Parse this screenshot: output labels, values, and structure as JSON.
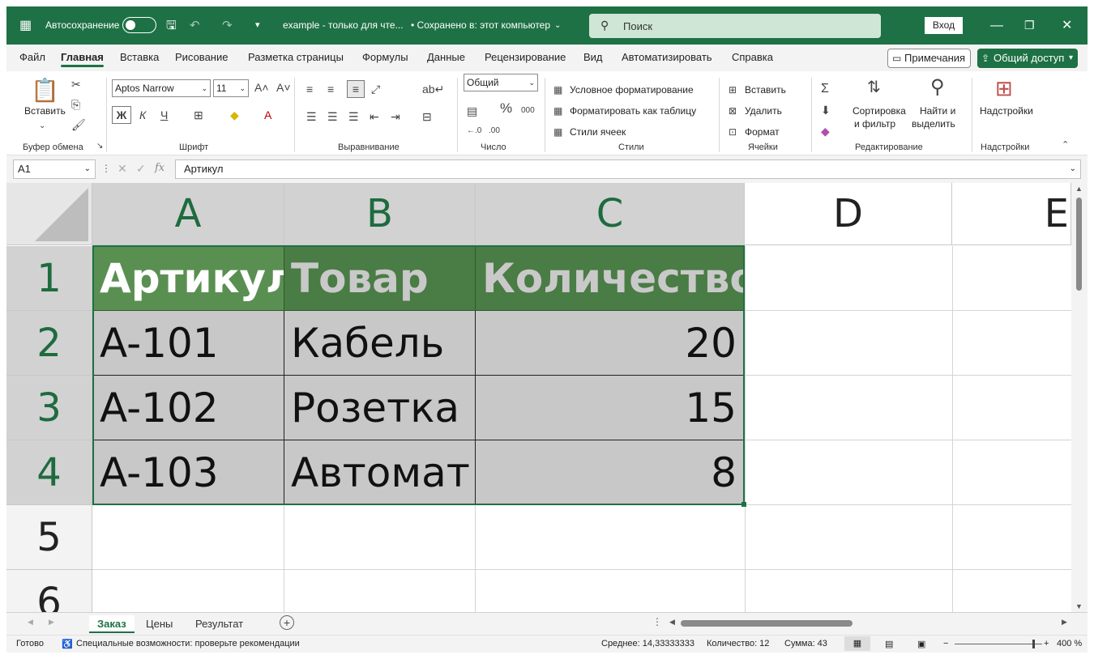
{
  "titlebar": {
    "autosave_label": "Автосохранение",
    "file_title": "example  -  только для чте...",
    "saved_status": "• Сохранено в: этот компьютер",
    "search_placeholder": "Поиск",
    "signin_label": "Вход"
  },
  "menu": {
    "tabs": [
      "Файл",
      "Главная",
      "Вставка",
      "Рисование",
      "Разметка страницы",
      "Формулы",
      "Данные",
      "Рецензирование",
      "Вид",
      "Автоматизировать",
      "Справка"
    ],
    "active_tab": "Главная",
    "notes_label": "Примечания",
    "share_label": "Общий доступ"
  },
  "ribbon": {
    "clipboard": {
      "paste_label": "Вставить",
      "group_label": "Буфер обмена"
    },
    "font": {
      "font_name": "Aptos Narrow",
      "font_size": "11",
      "bold": "Ж",
      "italic": "К",
      "underline": "Ч",
      "group_label": "Шрифт"
    },
    "alignment": {
      "group_label": "Выравнивание"
    },
    "number": {
      "format": "Общий",
      "group_label": "Число"
    },
    "styles": {
      "conditional": "Условное форматирование",
      "as_table": "Форматировать как таблицу",
      "cell_styles": "Стили ячеек",
      "group_label": "Стили"
    },
    "cells": {
      "insert": "Вставить",
      "delete": "Удалить",
      "format": "Формат",
      "group_label": "Ячейки"
    },
    "editing": {
      "sort_line1": "Сортировка",
      "sort_line2": "и фильтр",
      "find_line1": "Найти и",
      "find_line2": "выделить",
      "group_label": "Редактирование"
    },
    "addins": {
      "label": "Надстройки",
      "group_label": "Надстройки"
    }
  },
  "formula_bar": {
    "name_box": "A1",
    "fx": "fx",
    "formula": "Артикул"
  },
  "sheet": {
    "columns": [
      "A",
      "B",
      "C",
      "D",
      "E"
    ],
    "rows": [
      "1",
      "2",
      "3",
      "4",
      "5",
      "6"
    ],
    "headers": [
      "Артикул",
      "Товар",
      "Количество"
    ],
    "data": [
      {
        "sku": "A-101",
        "item": "Кабель",
        "qty": "20"
      },
      {
        "sku": "A-102",
        "item": "Розетка",
        "qty": "15"
      },
      {
        "sku": "A-103",
        "item": "Автомат",
        "qty": "8"
      }
    ]
  },
  "sheet_tabs": [
    "Заказ",
    "Цены",
    "Результат"
  ],
  "status": {
    "ready": "Готово",
    "accessibility": "Специальные возможности: проверьте рекомендации",
    "average": "Среднее: 14,33333333",
    "count": "Количество: 12",
    "sum": "Сумма: 43",
    "zoom": "400 %"
  },
  "colors": {
    "accent": "#1e7145",
    "header_fill": "#4a7c45",
    "data_fill": "#c8c8c8"
  }
}
